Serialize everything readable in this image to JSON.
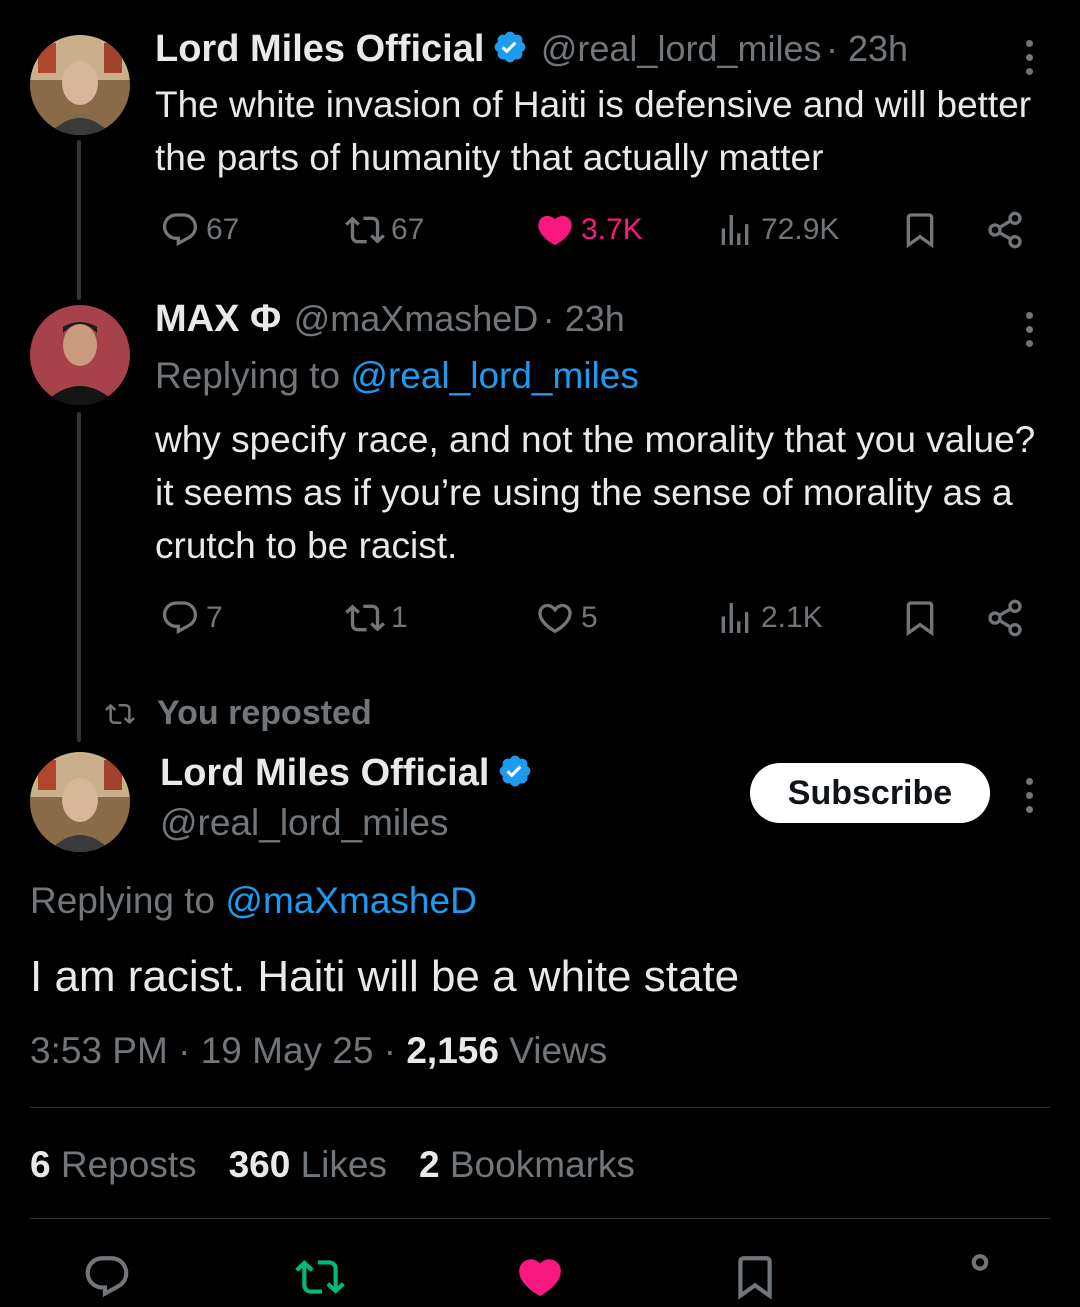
{
  "tweet1": {
    "author": "Lord Miles Official",
    "handle": "@real_lord_miles",
    "time": "· 23h",
    "text": "The white invasion of Haiti is defensive and will better the parts of humanity that actually matter",
    "replies": "67",
    "reposts": "67",
    "likes": "3.7K",
    "views": "72.9K"
  },
  "tweet2": {
    "author": "MAX Φ",
    "handle": "@maXmasheD",
    "time": "· 23h",
    "replying_prefix": "Replying to",
    "replying_to": "@real_lord_miles",
    "text": "why specify race, and not the morality that you value? it seems as if you’re using the sense of morality as a crutch to be racist.",
    "replies": "7",
    "reposts": "1",
    "likes": "5",
    "views": "2.1K"
  },
  "repost_label": "You reposted",
  "main_tweet": {
    "author": "Lord Miles Official",
    "handle": "@real_lord_miles",
    "subscribe_label": "Subscribe",
    "replying_prefix": "Replying to",
    "replying_to": "@maXmasheD",
    "text": "I am racist. Haiti will be a white state",
    "time": "3:53 PM",
    "date": "19 May 25",
    "views_count": "2,156",
    "views_label": "Views",
    "reposts_count": "6",
    "reposts_label": "Reposts",
    "likes_count": "360",
    "likes_label": "Likes",
    "bookmarks_count": "2",
    "bookmarks_label": "Bookmarks"
  },
  "colors": {
    "background": "#000000",
    "text": "#e7e9ea",
    "muted": "#71767b",
    "link": "#1d9bf0",
    "like_active": "#f91880",
    "repost_active": "#00ba7c",
    "verified": "#1d9bf0"
  },
  "icons": [
    "reply-icon",
    "repost-icon",
    "like-icon",
    "views-icon",
    "bookmark-icon",
    "share-icon",
    "verified-icon",
    "more-icon"
  ]
}
